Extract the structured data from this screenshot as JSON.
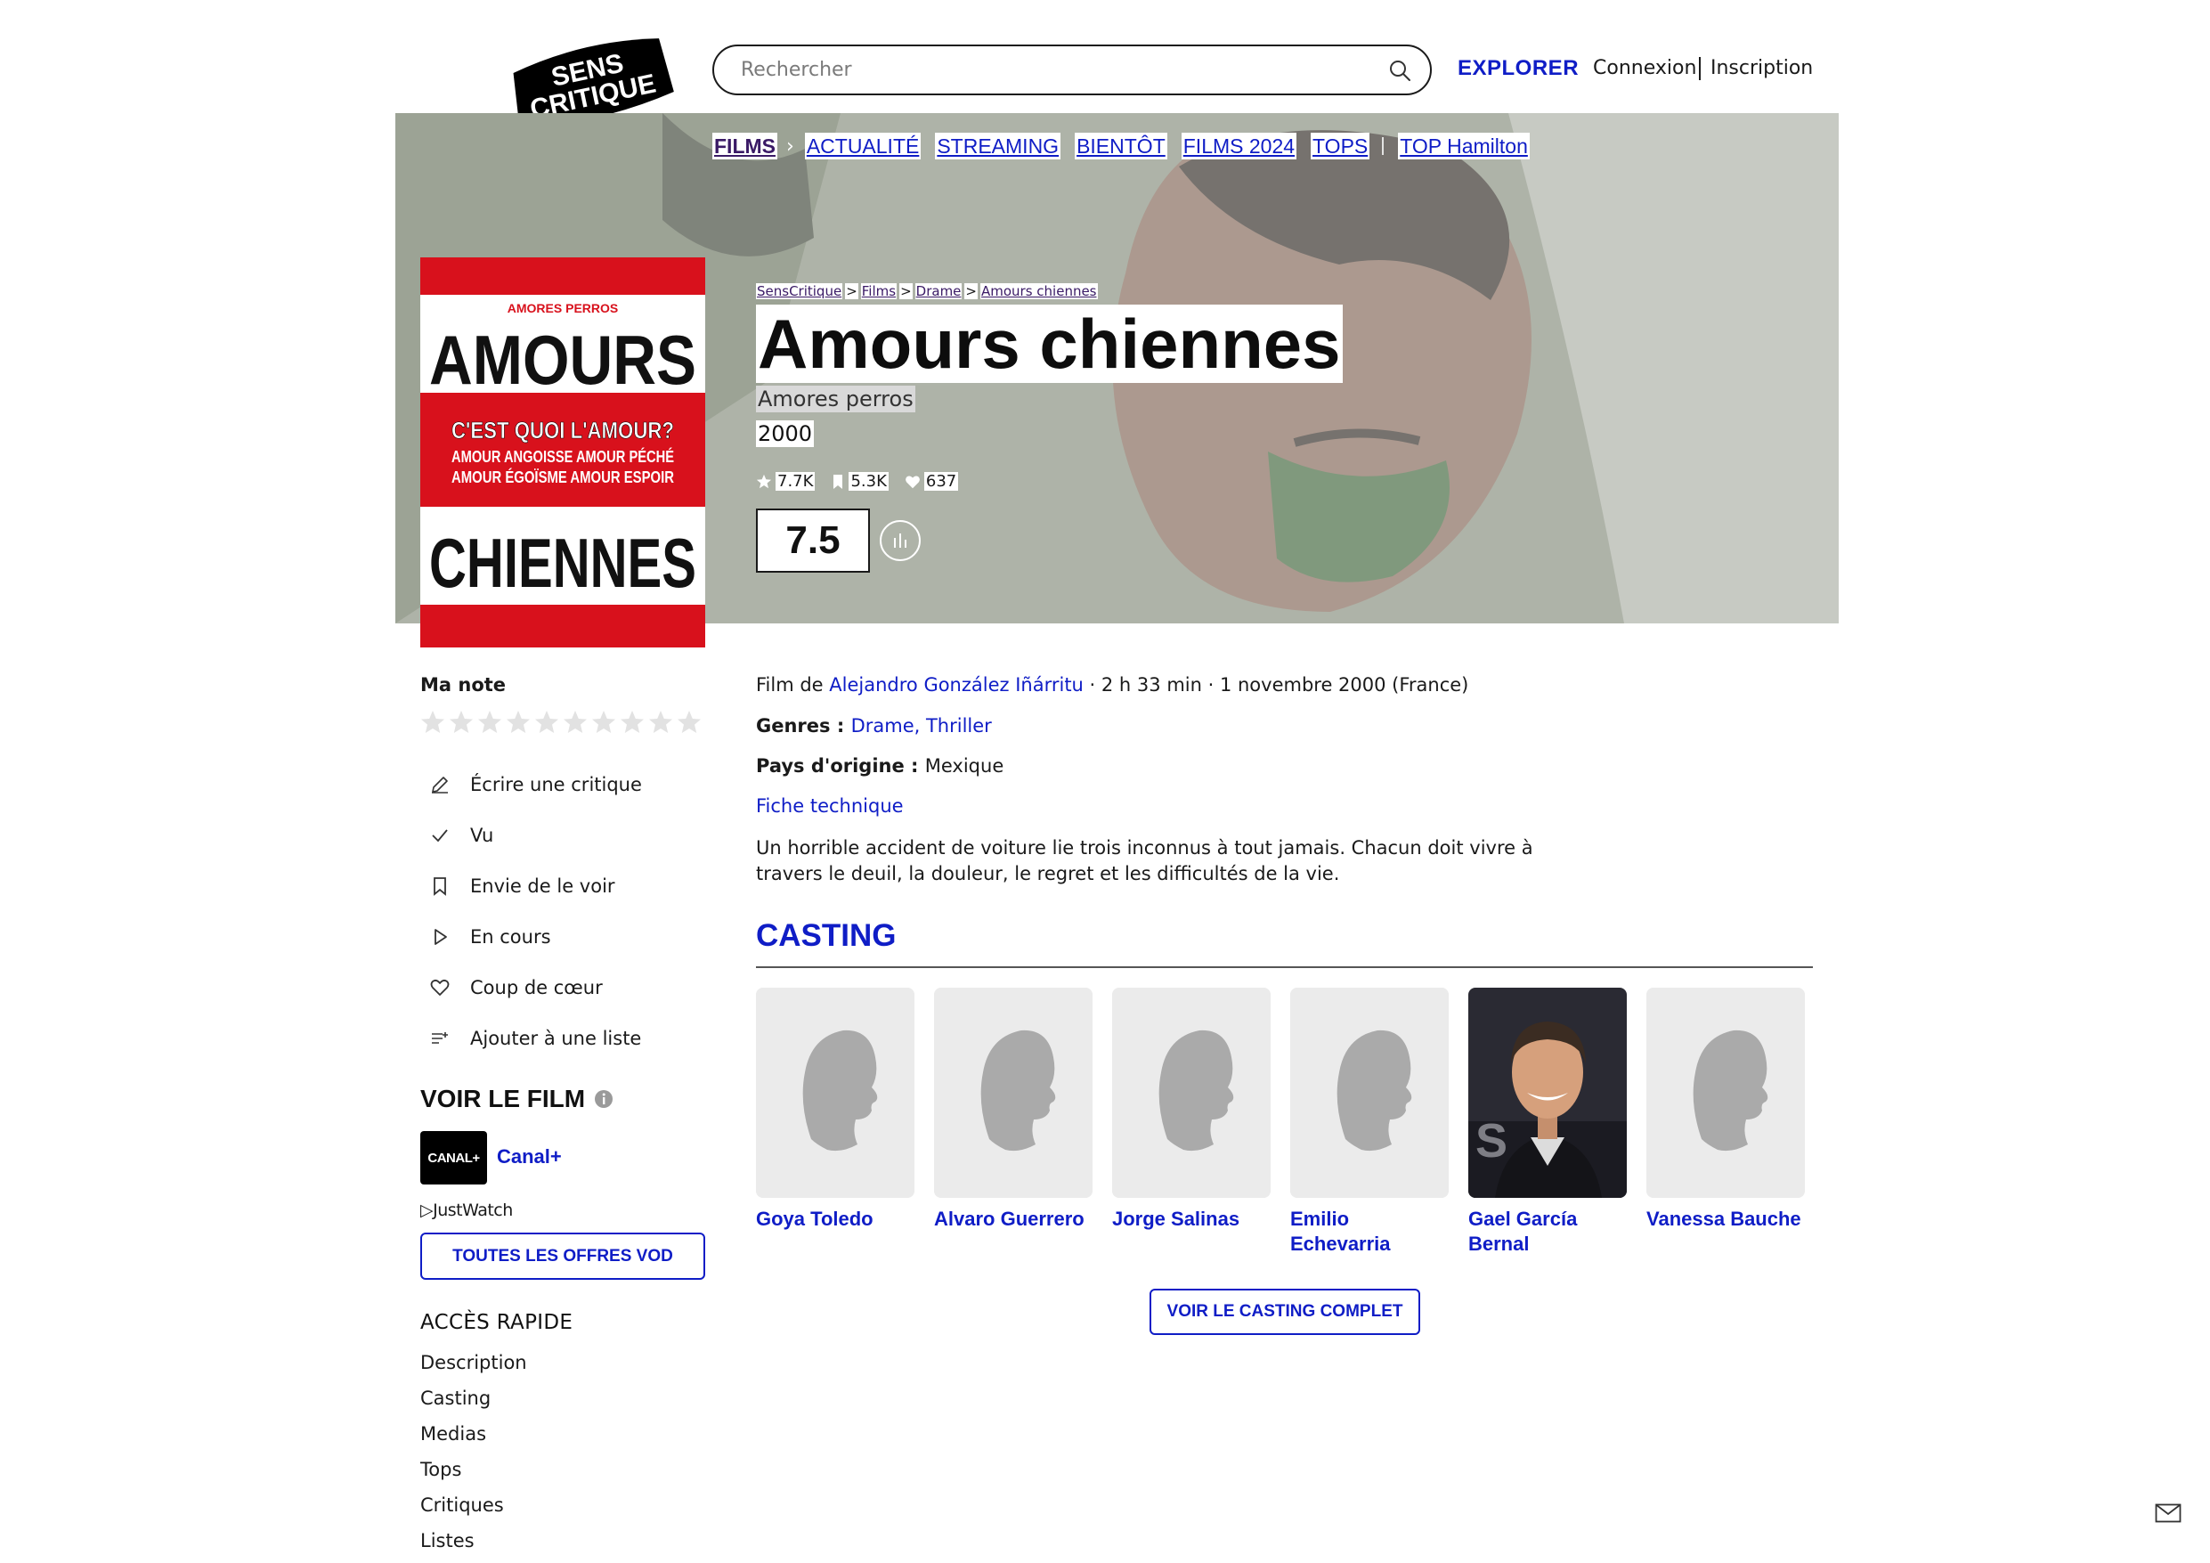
{
  "header": {
    "logo_line1": "SENS",
    "logo_line2": "CRITIQUE",
    "search_placeholder": "Rechercher",
    "explore": "EXPLORER",
    "login": "Connexion",
    "signup": "Inscription"
  },
  "subnav": {
    "items": [
      "FILMS",
      "ACTUALITÉ",
      "STREAMING",
      "BIENTÔT",
      "FILMS 2024",
      "TOPS",
      "TOP Hamilton"
    ]
  },
  "breadcrumb": [
    "SensCritique",
    "Films",
    "Drame",
    "Amours chiennes"
  ],
  "poster": {
    "top_text": "AMORES PERROS",
    "word1": "AMOURS",
    "tagline": "C'EST QUOI L'AMOUR?",
    "line2": "AMOUR ANGOISSE AMOUR PÉCHÉ",
    "line3": "AMOUR ÉGOÏSME AMOUR ESPOIR",
    "word2": "CHIENNES"
  },
  "film": {
    "title": "Amours chiennes",
    "original_title": "Amores perros",
    "year": "2000",
    "stats": {
      "ratings": "7.7K",
      "wishlist": "5.3K",
      "favorites": "637"
    },
    "score": "7.5",
    "info_prefix": "Film de ",
    "director": "Alejandro González Iñárritu",
    "info_suffix": " · 2 h 33 min · 1 novembre 2000 (France)",
    "genres_label": "Genres : ",
    "genres": "Drame, Thriller",
    "country_label": "Pays d'origine : ",
    "country": "Mexique",
    "tech_sheet": "Fiche technique",
    "synopsis": "Un horrible accident de voiture lie trois inconnus à tout jamais. Chacun doit vivre à travers le deuil, la douleur, le regret et les difficultés de la vie."
  },
  "my_rating": {
    "label": "Ma note",
    "max_stars": 10,
    "value": 0
  },
  "actions": [
    {
      "icon": "pencil-icon",
      "label": "Écrire une critique"
    },
    {
      "icon": "check-icon",
      "label": "Vu"
    },
    {
      "icon": "bookmark-icon",
      "label": "Envie de le voir"
    },
    {
      "icon": "play-icon",
      "label": "En cours"
    },
    {
      "icon": "heart-icon",
      "label": "Coup de cœur"
    },
    {
      "icon": "list-add-icon",
      "label": "Ajouter à une liste"
    }
  ],
  "watch": {
    "title": "VOIR LE FILM",
    "provider_logo": "CANAL+",
    "provider": "Canal+",
    "justwatch": "JustWatch",
    "vod_button": "TOUTES LES OFFRES VOD"
  },
  "quick_access": {
    "title": "ACCÈS RAPIDE",
    "links": [
      "Description",
      "Casting",
      "Medias",
      "Tops",
      "Critiques",
      "Listes"
    ]
  },
  "casting": {
    "title": "CASTING",
    "actors": [
      {
        "name": "Goya Toledo",
        "photo": "placeholder"
      },
      {
        "name": "Alvaro Guerrero",
        "photo": "placeholder"
      },
      {
        "name": "Jorge Salinas",
        "photo": "placeholder"
      },
      {
        "name": "Emilio Echevarria",
        "photo": "placeholder"
      },
      {
        "name": "Gael García Bernal",
        "photo": "portrait"
      },
      {
        "name": "Vanessa Bauche",
        "photo": "placeholder"
      }
    ],
    "full_cast_button": "VOIR LE CASTING COMPLET"
  },
  "colors": {
    "accent": "#0f1dc6",
    "poster_red": "#d8111c",
    "purple": "#3a1a66"
  }
}
